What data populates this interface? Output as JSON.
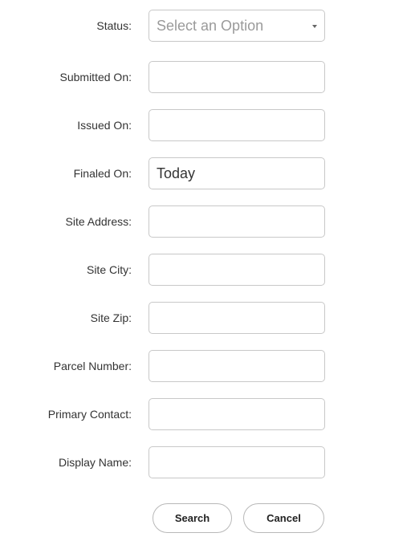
{
  "form": {
    "status": {
      "label": "Status:",
      "selected": "Select an Option",
      "icon": "chevron-down-icon"
    },
    "submitted_on": {
      "label": "Submitted On:",
      "value": ""
    },
    "issued_on": {
      "label": "Issued On:",
      "value": ""
    },
    "finaled_on": {
      "label": "Finaled On:",
      "value": "Today"
    },
    "site_address": {
      "label": "Site Address:",
      "value": ""
    },
    "site_city": {
      "label": "Site City:",
      "value": ""
    },
    "site_zip": {
      "label": "Site Zip:",
      "value": ""
    },
    "parcel_number": {
      "label": "Parcel Number:",
      "value": ""
    },
    "primary_contact": {
      "label": "Primary Contact:",
      "value": ""
    },
    "display_name": {
      "label": "Display Name:",
      "value": ""
    }
  },
  "buttons": {
    "search_label": "Search",
    "cancel_label": "Cancel"
  }
}
